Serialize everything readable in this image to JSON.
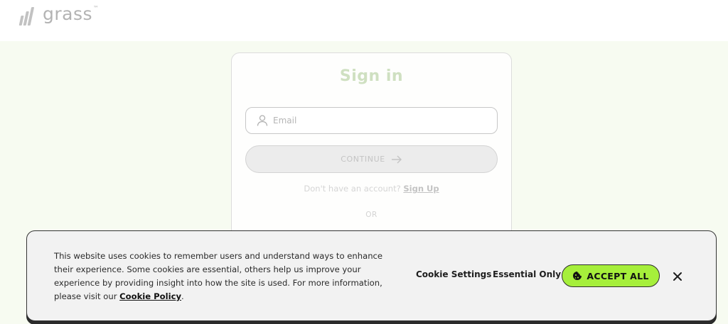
{
  "header": {
    "logo_text": "grass",
    "logo_tm": "™",
    "logo_icon": "grass-bars-icon"
  },
  "signin": {
    "title": "Sign in",
    "email_placeholder": "Email",
    "email_icon": "user-icon",
    "continue_label": "CONTINUE",
    "continue_icon": "arrow-right-icon",
    "no_account_text": "Don't have an account?",
    "signup_label": "Sign Up",
    "or_text": "OR"
  },
  "cookie_banner": {
    "message": "This website uses cookies to remember users and understand ways to enhance their experience. Some cookies are essential, others help us improve your experience by providing insight into how the site is used. For more information, please visit our",
    "policy_link": "Cookie Policy",
    "period": ".",
    "settings_label": "Cookie Settings",
    "essential_label": "Essential Only",
    "accept_label": "ACCEPT ALL",
    "accept_icon": "cookie-icon",
    "close_icon": "close-icon"
  },
  "colors": {
    "accent_green": "#a6ef3b",
    "page_band": "#f7fbf1",
    "title_green": "#cfe0c1"
  }
}
